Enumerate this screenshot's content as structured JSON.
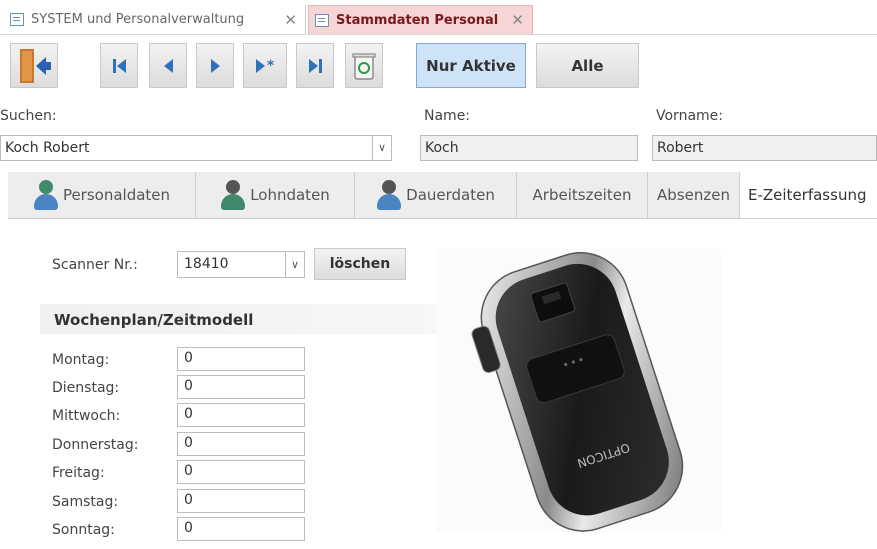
{
  "doc_tabs": [
    {
      "label": "SYSTEM und Personalverwaltung"
    },
    {
      "label": "Stammdaten Personal"
    }
  ],
  "toolbar": {
    "exit_icon": "exit-door-icon",
    "nav_icons": [
      "first-record-icon",
      "previous-record-icon",
      "next-record-icon",
      "new-record-icon",
      "last-record-icon"
    ],
    "delete_icon": "recycle-bin-icon",
    "nur_aktive_label": "Nur Aktive",
    "alle_label": "Alle"
  },
  "search": {
    "label": "Suchen:",
    "value": "Koch Robert"
  },
  "name": {
    "label": "Name:",
    "value": "Koch"
  },
  "vorname": {
    "label": "Vorname:",
    "value": "Robert"
  },
  "subtabs": [
    {
      "label": "Personaldaten",
      "icon": "person-icon"
    },
    {
      "label": "Lohndaten",
      "icon": "people-icon"
    },
    {
      "label": "Dauerdaten",
      "icon": "people-clipboard-icon"
    },
    {
      "label": "Arbeitszeiten"
    },
    {
      "label": "Absenzen"
    },
    {
      "label": "E-Zeiterfassung"
    }
  ],
  "scanner": {
    "label": "Scanner Nr.:",
    "value": "18410",
    "delete_label": "löschen"
  },
  "wochenplan": {
    "title": "Wochenplan/Zeitmodell",
    "days": [
      {
        "label": "Montag:",
        "value": "0"
      },
      {
        "label": "Dienstag:",
        "value": "0"
      },
      {
        "label": "Mittwoch:",
        "value": "0"
      },
      {
        "label": "Donnerstag:",
        "value": "0"
      },
      {
        "label": "Freitag:",
        "value": "0"
      },
      {
        "label": "Samstag:",
        "value": "0"
      },
      {
        "label": "Sonntag:",
        "value": "0"
      }
    ]
  },
  "device": {
    "brand_text": "OPTICON"
  },
  "colors": {
    "active_tab_bg": "#f5d5d5",
    "active_tab_text": "#7a1a1a",
    "nav_blue": "#3071b8",
    "nur_aktive_bg": "#cfe3f6"
  }
}
